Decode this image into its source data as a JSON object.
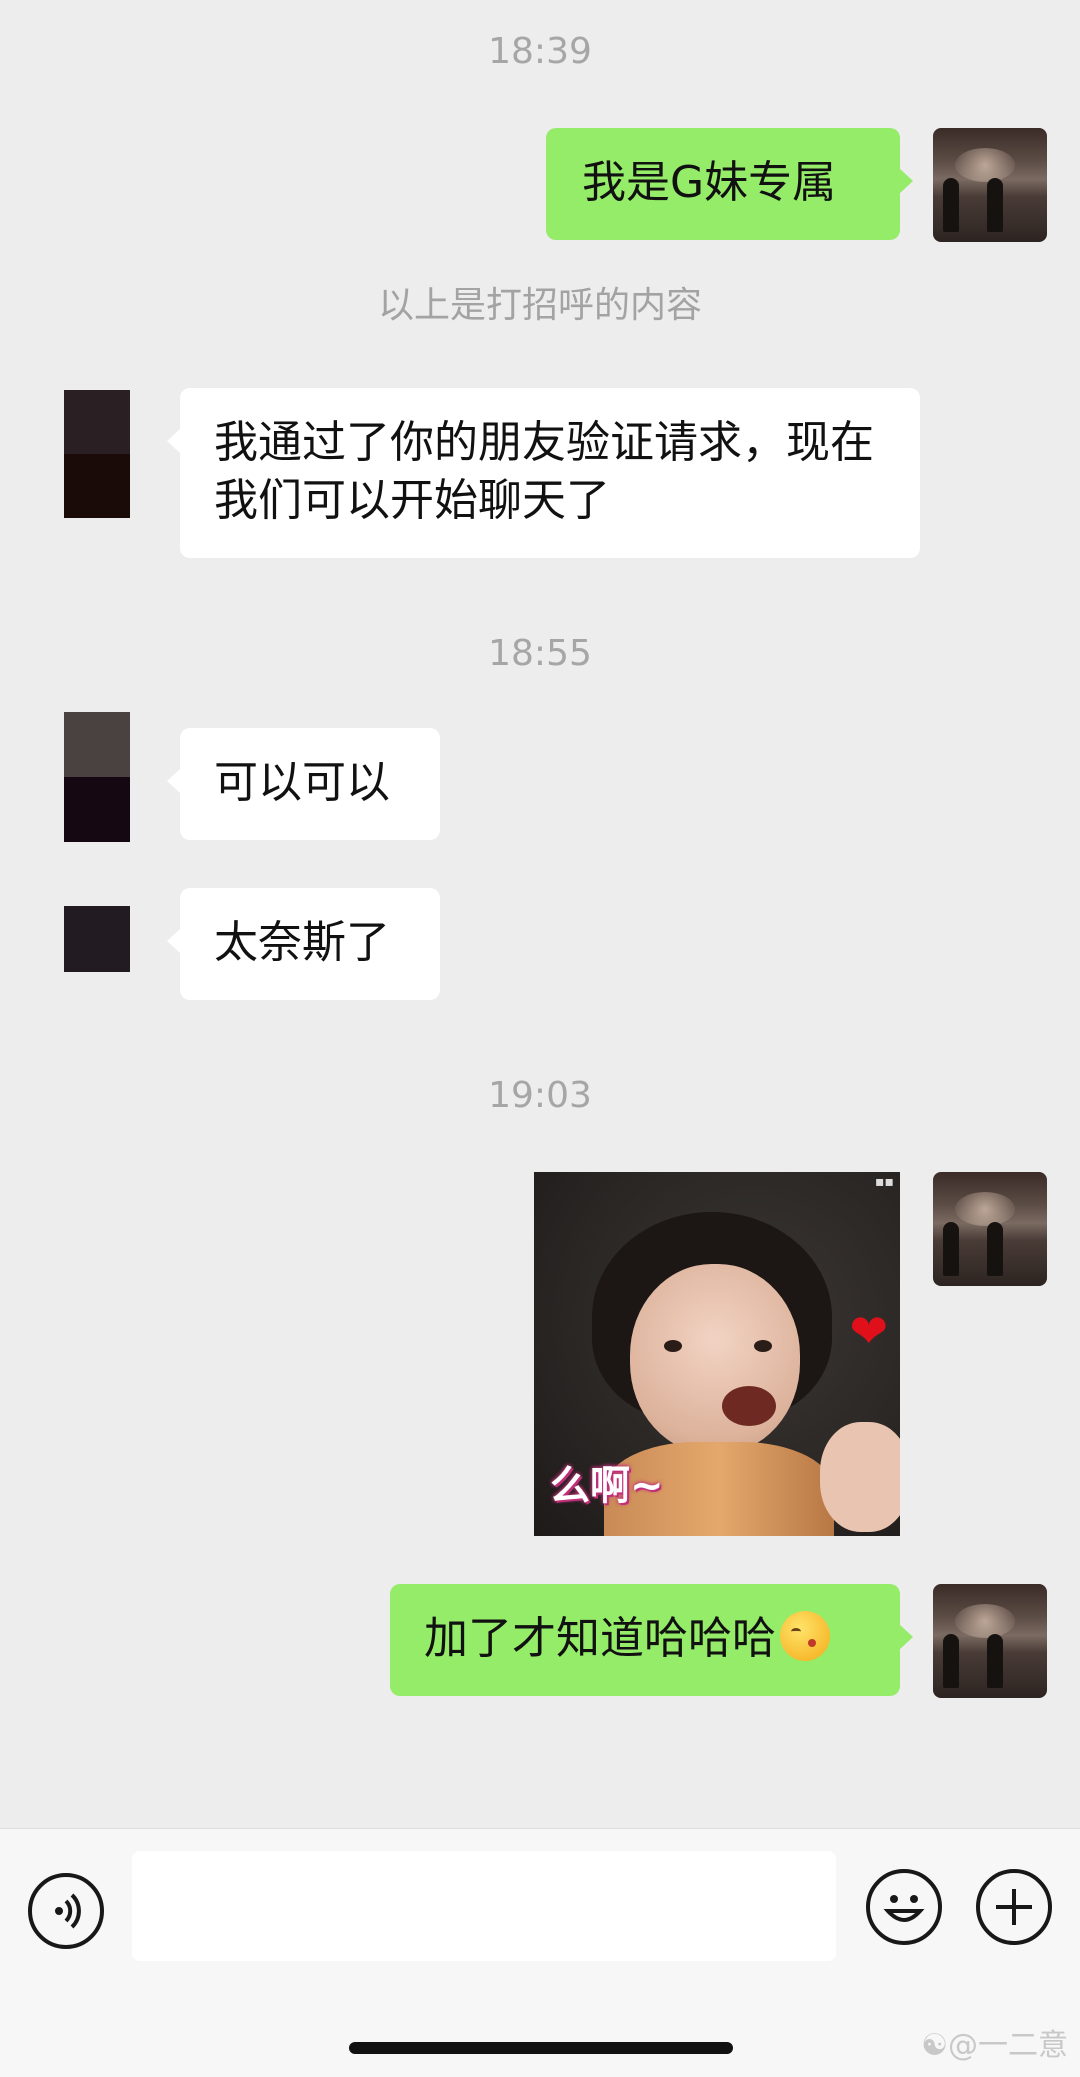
{
  "timestamps": [
    "18:39",
    "18:55",
    "19:03"
  ],
  "system_message": "以上是打招呼的内容",
  "messages": [
    {
      "from": "me",
      "text": "我是G妹专属"
    },
    {
      "from": "contact",
      "text": "我通过了你的朋友验证请求，现在我们可以开始聊天了"
    },
    {
      "from": "contact",
      "text": "可以可以"
    },
    {
      "from": "contact",
      "text": "太奈斯了"
    },
    {
      "from": "me",
      "type": "sticker",
      "caption": "么啊~"
    },
    {
      "from": "me",
      "text": "加了才知道哈哈哈",
      "emoji": "kissing-face-emoji"
    }
  ],
  "input_bar": {
    "voice_icon": "voice-icon",
    "emoji_icon": "emoji-icon",
    "plus_icon": "plus-icon"
  },
  "watermark": "@一二意",
  "colors": {
    "background": "#ededed",
    "my_bubble": "#95ec69",
    "their_bubble": "#ffffff",
    "timestamp": "#a6a6a6"
  }
}
